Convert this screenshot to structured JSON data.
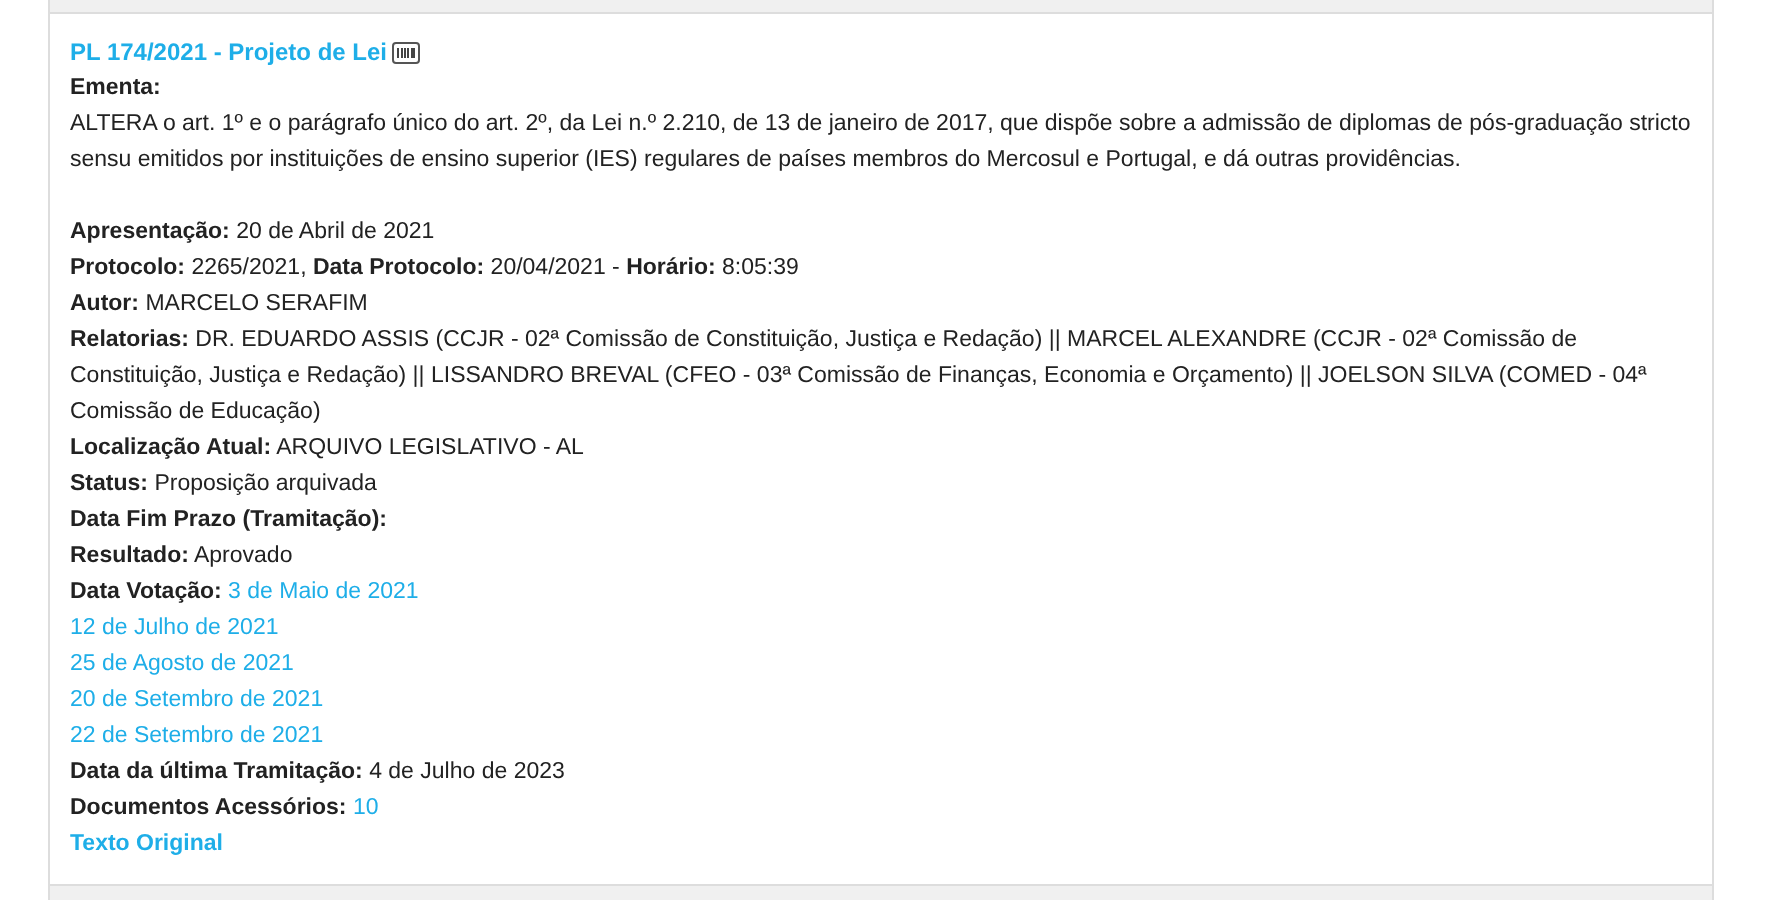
{
  "title": "PL 174/2021 - Projeto de Lei",
  "ementa_label": "Ementa:",
  "ementa_text": "ALTERA o art. 1º e o parágrafo único do art. 2º, da Lei n.º 2.210, de 13 de janeiro de 2017, que dispõe sobre a admissão de diplomas de pós-graduação stricto sensu emitidos por instituições de ensino superior (IES) regulares de países membros do Mercosul e Portugal, e dá outras providências.",
  "lines": [
    {
      "parts": [
        {
          "kind": "label",
          "text": "Apresentação:"
        },
        {
          "kind": "value",
          "text": "20 de Abril de 2021"
        }
      ]
    },
    {
      "parts": [
        {
          "kind": "label",
          "text": "Protocolo:"
        },
        {
          "kind": "value",
          "text": "2265/2021,"
        },
        {
          "kind": "label",
          "text": "Data Protocolo:"
        },
        {
          "kind": "value",
          "text": "20/04/2021 -"
        },
        {
          "kind": "label",
          "text": "Horário:"
        },
        {
          "kind": "value",
          "text": "8:05:39"
        }
      ]
    },
    {
      "parts": [
        {
          "kind": "label",
          "text": "Autor:"
        },
        {
          "kind": "value",
          "text": "MARCELO SERAFIM"
        }
      ]
    },
    {
      "parts": [
        {
          "kind": "label",
          "text": "Relatorias:"
        },
        {
          "kind": "value",
          "text": "DR. EDUARDO ASSIS (CCJR - 02ª Comissão de Constituição, Justiça e Redação) || MARCEL ALEXANDRE (CCJR - 02ª Comissão de Constituição, Justiça e Redação) || LISSANDRO BREVAL (CFEO - 03ª Comissão de Finanças, Economia e Orçamento) || JOELSON SILVA (COMED - 04ª Comissão de Educação)"
        }
      ]
    },
    {
      "parts": [
        {
          "kind": "label",
          "text": "Localização Atual:"
        },
        {
          "kind": "value",
          "text": "ARQUIVO LEGISLATIVO - AL"
        }
      ]
    },
    {
      "parts": [
        {
          "kind": "label",
          "text": "Status:"
        },
        {
          "kind": "value",
          "text": "Proposição arquivada"
        }
      ]
    },
    {
      "parts": [
        {
          "kind": "label",
          "text": "Data Fim Prazo (Tramitação):"
        }
      ]
    },
    {
      "parts": [
        {
          "kind": "label",
          "text": "Resultado:"
        },
        {
          "kind": "value",
          "text": "Aprovado"
        }
      ]
    },
    {
      "parts": [
        {
          "kind": "label",
          "text": "Data Votação:"
        },
        {
          "kind": "link",
          "text": "3 de Maio de 2021"
        }
      ]
    },
    {
      "parts": [
        {
          "kind": "link",
          "text": "12 de Julho de 2021"
        }
      ]
    },
    {
      "parts": [
        {
          "kind": "link",
          "text": "25 de Agosto de 2021"
        }
      ]
    },
    {
      "parts": [
        {
          "kind": "link",
          "text": "20 de Setembro de 2021"
        }
      ]
    },
    {
      "parts": [
        {
          "kind": "link",
          "text": "22 de Setembro de 2021"
        }
      ]
    },
    {
      "parts": [
        {
          "kind": "label",
          "text": "Data da última Tramitação:"
        },
        {
          "kind": "value",
          "text": "4 de Julho de 2023"
        }
      ]
    },
    {
      "parts": [
        {
          "kind": "label",
          "text": "Documentos Acessórios:"
        },
        {
          "kind": "link",
          "text": "10"
        }
      ]
    },
    {
      "parts": [
        {
          "kind": "strong_link",
          "text": "Texto Original"
        }
      ]
    }
  ]
}
